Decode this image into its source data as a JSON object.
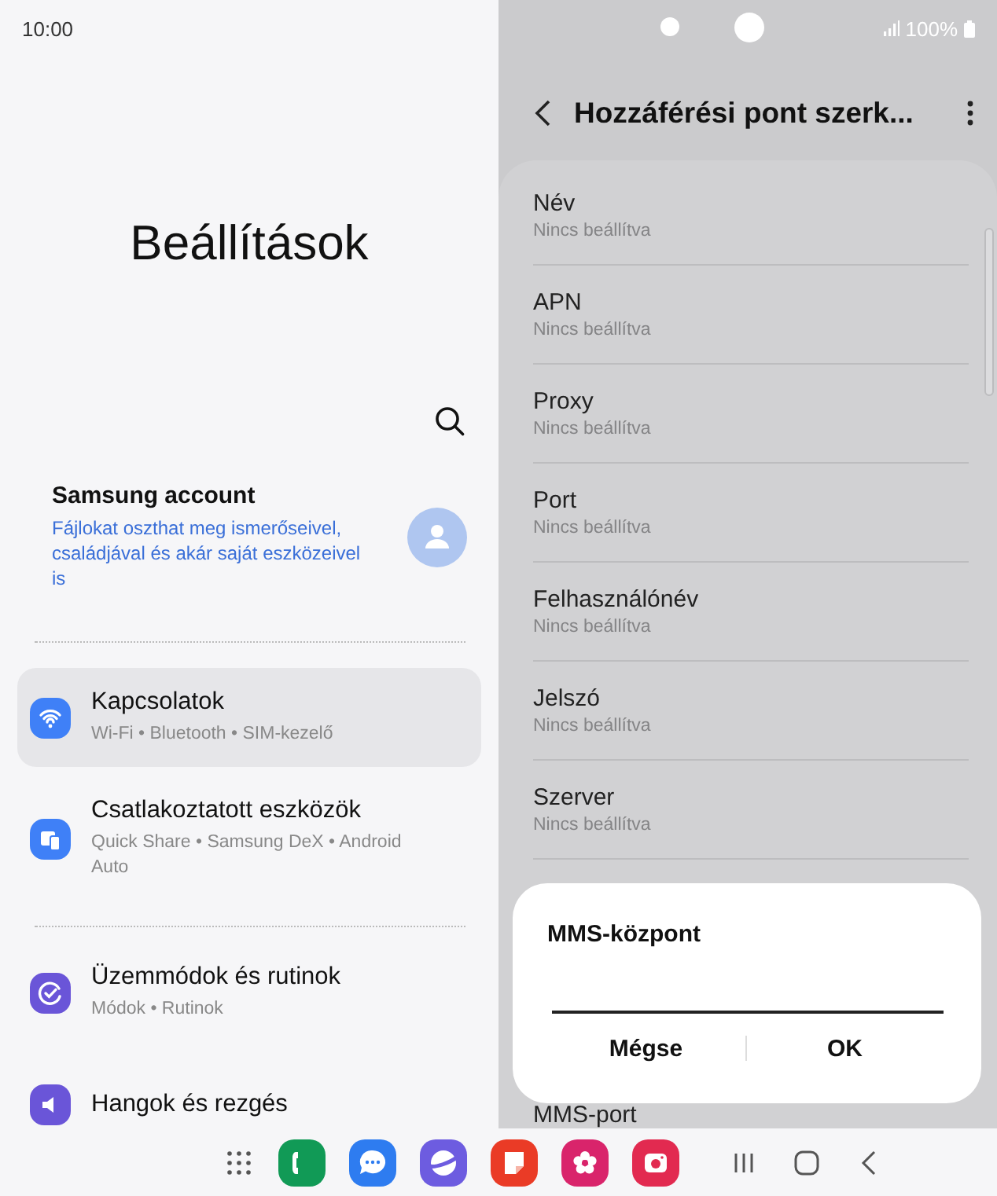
{
  "status_bar": {
    "time": "10:00",
    "battery": "100%"
  },
  "settings": {
    "title": "Beállítások",
    "account": {
      "name": "Samsung account",
      "description": "Fájlokat oszthat meg ismerőseivel, családjával és akár saját eszközeivel is"
    },
    "groups": [
      [
        {
          "kind": "wifi",
          "title": "Kapcsolatok",
          "subtitle": "Wi-Fi • Bluetooth • SIM-kezelő",
          "selected": true
        },
        {
          "kind": "devices",
          "title": "Csatlakoztatott eszközök",
          "subtitle": "Quick Share • Samsung DeX • Android Auto",
          "selected": false
        }
      ],
      [
        {
          "kind": "modes",
          "title": "Üzemmódok és rutinok",
          "subtitle": "Módok • Rutinok",
          "selected": false
        },
        {
          "kind": "sound",
          "title": "Hangok és rezgés",
          "selected": false
        }
      ]
    ]
  },
  "editor": {
    "title": "Hozzáférési pont szerk...",
    "fields": [
      {
        "label": "Név",
        "value": "Nincs beállítva"
      },
      {
        "label": "APN",
        "value": "Nincs beállítva"
      },
      {
        "label": "Proxy",
        "value": "Nincs beállítva"
      },
      {
        "label": "Port",
        "value": "Nincs beállítva"
      },
      {
        "label": "Felhasználónév",
        "value": "Nincs beállítva"
      },
      {
        "label": "Jelszó",
        "value": "Nincs beállítva"
      },
      {
        "label": "Szerver",
        "value": "Nincs beállítva"
      },
      {
        "label": "MMS-port"
      }
    ],
    "dialog": {
      "title": "MMS-központ",
      "buttons": [
        "Mégse",
        "OK"
      ]
    }
  },
  "taskbar": {
    "apps": [
      {
        "kind": "phone"
      },
      {
        "kind": "messages"
      },
      {
        "kind": "internet"
      },
      {
        "kind": "notes"
      },
      {
        "kind": "gallery"
      },
      {
        "kind": "camera"
      }
    ]
  }
}
